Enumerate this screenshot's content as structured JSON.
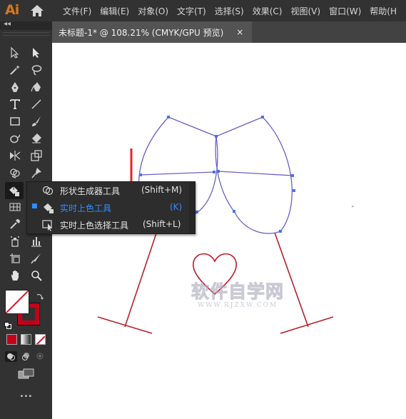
{
  "app": {
    "logo": "Ai"
  },
  "menubar": {
    "items": [
      {
        "label": "文件(F)"
      },
      {
        "label": "编辑(E)"
      },
      {
        "label": "对象(O)"
      },
      {
        "label": "文字(T)"
      },
      {
        "label": "选择(S)"
      },
      {
        "label": "效果(C)"
      },
      {
        "label": "视图(V)"
      },
      {
        "label": "窗口(W)"
      },
      {
        "label": "帮助(H"
      }
    ]
  },
  "document_tab": {
    "title": "未标题-1* @ 108.21% (CMYK/GPU 预览)",
    "close": "×"
  },
  "toolbar": {
    "collapse": "◂◂",
    "tools": [
      "selection-tool",
      "direct-selection-tool",
      "magic-wand-tool",
      "lasso-tool",
      "pen-tool",
      "curvature-tool",
      "type-tool",
      "line-segment-tool",
      "rectangle-tool",
      "paintbrush-tool",
      "shaper-tool",
      "eraser-tool",
      "width-tool",
      "free-transform-tool",
      "shape-builder-tool",
      "puppet-warp-tool",
      "live-paint-bucket-tool",
      "perspective-grid-tool",
      "eyedropper-tool",
      "blend-tool",
      "symbol-sprayer-tool",
      "column-graph-tool",
      "artboard-tool",
      "slice-tool",
      "hand-tool",
      "zoom-tool"
    ],
    "fill_color": "#ffffff",
    "stroke_color": "#c40018",
    "more": "..."
  },
  "flyout": {
    "items": [
      {
        "label": "形状生成器工具",
        "shortcut": "(Shift+M)",
        "selected": false
      },
      {
        "label": "实时上色工具",
        "shortcut": "(K)",
        "selected": true
      },
      {
        "label": "实时上色选择工具",
        "shortcut": "(Shift+L)",
        "selected": false
      }
    ]
  },
  "canvas": {
    "path_color": "#6a60c4",
    "anchor_color": "#4a72e8",
    "stem_color": "#b81f2b",
    "heart_color": "#c0182a",
    "arrow_color": "#e8232a"
  },
  "watermark": {
    "line1": "软件自学网",
    "line2": "WWW.RJZXW.COM"
  }
}
